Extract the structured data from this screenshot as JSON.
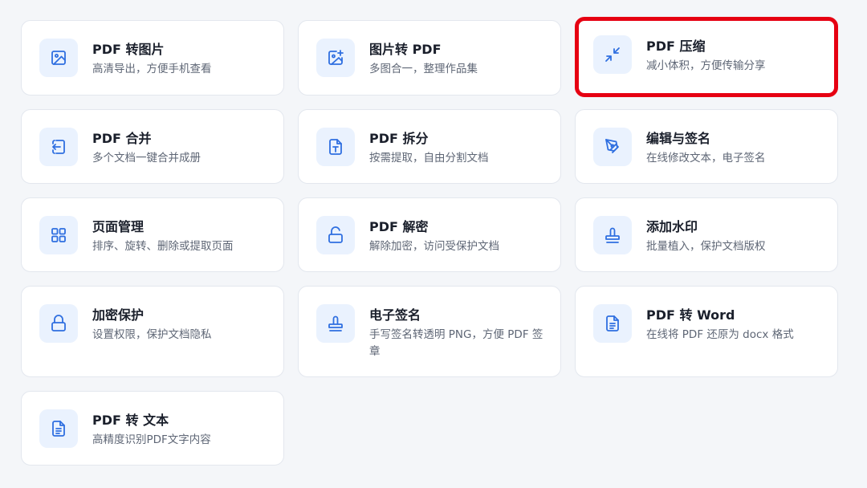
{
  "tools": [
    {
      "title": "PDF 转图片",
      "desc": "高清导出，方便手机查看",
      "icon": "image-icon"
    },
    {
      "title": "图片转 PDF",
      "desc": "多图合一，整理作品集",
      "icon": "image-add-icon"
    },
    {
      "title": "PDF 压缩",
      "desc": "减小体积，方便传输分享",
      "icon": "compress-icon"
    },
    {
      "title": "PDF 合并",
      "desc": "多个文档一键合并成册",
      "icon": "merge-icon"
    },
    {
      "title": "PDF 拆分",
      "desc": "按需提取，自由分割文档",
      "icon": "split-icon"
    },
    {
      "title": "编辑与签名",
      "desc": "在线修改文本，电子签名",
      "icon": "pen-icon"
    },
    {
      "title": "页面管理",
      "desc": "排序、旋转、删除或提取页面",
      "icon": "grid-icon"
    },
    {
      "title": "PDF 解密",
      "desc": "解除加密，访问受保护文档",
      "icon": "unlock-icon"
    },
    {
      "title": "添加水印",
      "desc": "批量植入，保护文档版权",
      "icon": "stamp-icon"
    },
    {
      "title": "加密保护",
      "desc": "设置权限，保护文档隐私",
      "icon": "lock-icon"
    },
    {
      "title": "电子签名",
      "desc": "手写签名转透明 PNG，方便 PDF 签章",
      "icon": "signature-stamp-icon"
    },
    {
      "title": "PDF 转 Word",
      "desc": "在线将 PDF 还原为 docx 格式",
      "icon": "document-icon"
    },
    {
      "title": "PDF 转 文本",
      "desc": "高精度识别PDF文字内容",
      "icon": "text-document-icon"
    }
  ],
  "colors": {
    "accent": "#2f6fe0",
    "icon_bg": "#eaf2fe",
    "highlight": "#e60012"
  }
}
